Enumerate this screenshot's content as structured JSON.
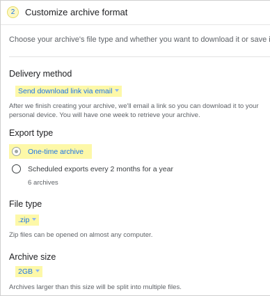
{
  "step": {
    "number": "2",
    "title": "Customize archive format"
  },
  "intro": "Choose your archive's file type and whether you want to download it or save it in the cloud",
  "delivery": {
    "title": "Delivery method",
    "selected": "Send download link via email",
    "description_line1": "After we finish creating your archive, we'll email a link so you can download it to your",
    "description_line2": "personal device. You will have one week to retrieve your archive."
  },
  "export": {
    "title": "Export type",
    "options": [
      {
        "label": "One-time archive",
        "selected": true
      },
      {
        "label": "Scheduled exports every 2 months for a year",
        "sub": "6 archives",
        "selected": false
      }
    ]
  },
  "filetype": {
    "title": "File type",
    "selected": ".zip",
    "description": "Zip files can be opened on almost any computer."
  },
  "archive_size": {
    "title": "Archive size",
    "selected": "2GB",
    "description": "Archives larger than this size will be split into multiple files."
  },
  "colors": {
    "highlight": "#fdf8a8",
    "accent": "#1a73e8"
  }
}
